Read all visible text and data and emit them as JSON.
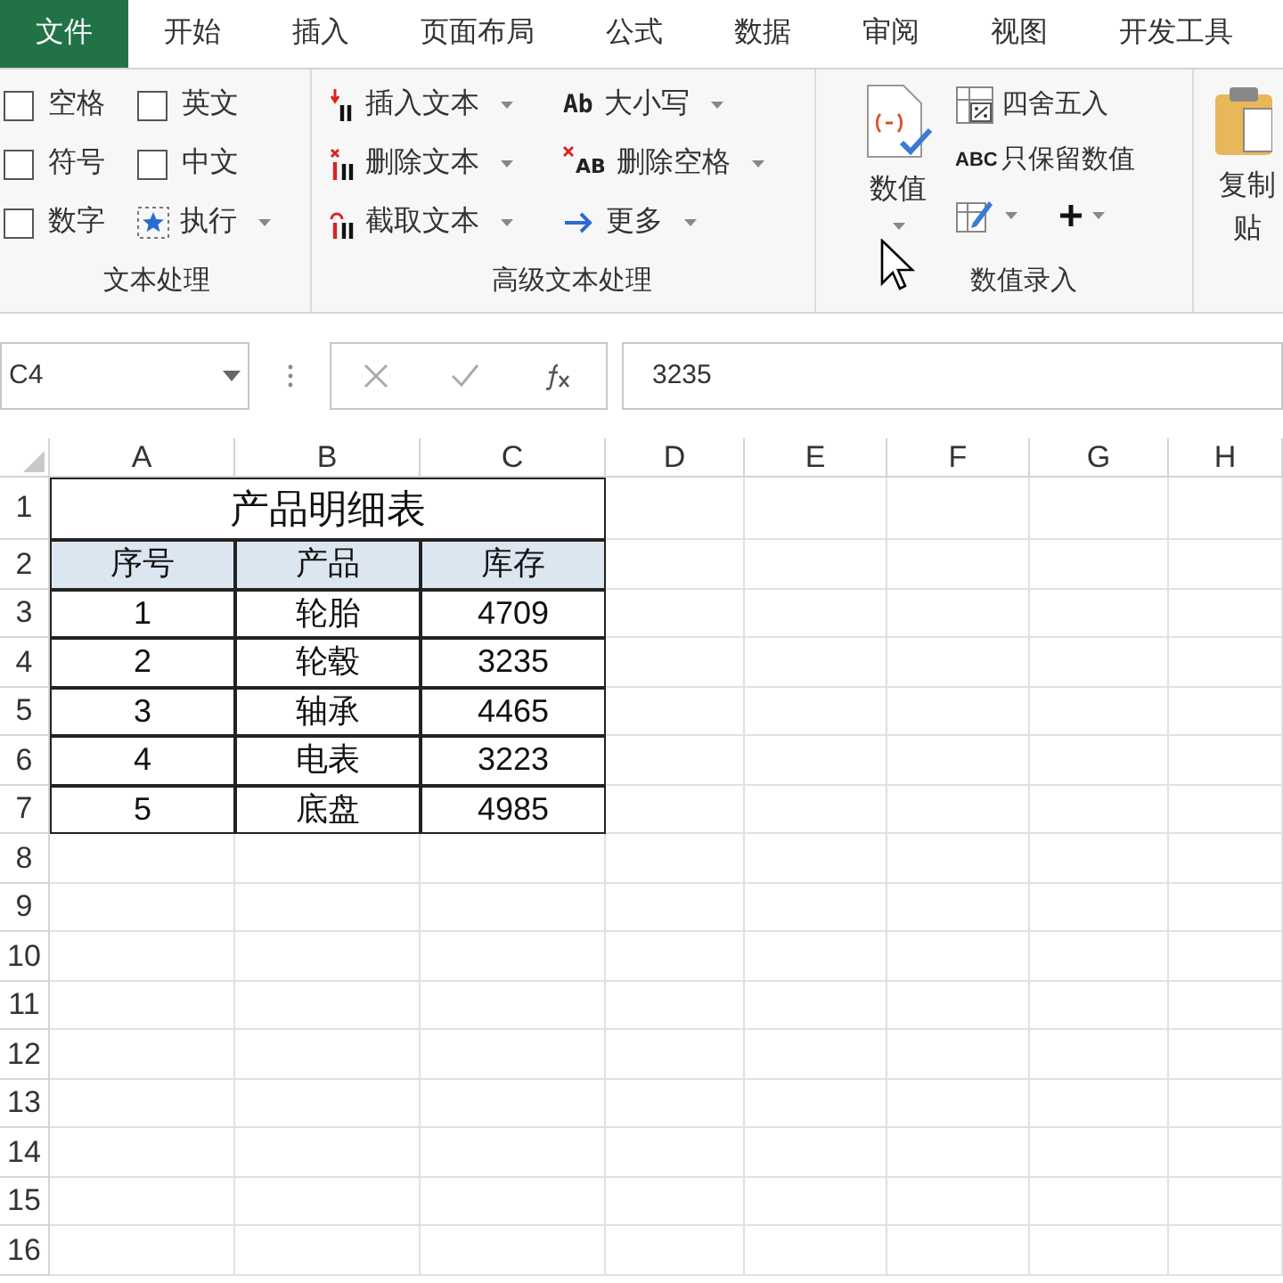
{
  "tabs": [
    {
      "label": "文件",
      "kind": "file"
    },
    {
      "label": "开始",
      "kind": "tab"
    },
    {
      "label": "插入",
      "kind": "tab"
    },
    {
      "label": "页面布局",
      "kind": "tab"
    },
    {
      "label": "公式",
      "kind": "tab"
    },
    {
      "label": "数据",
      "kind": "tab"
    },
    {
      "label": "审阅",
      "kind": "tab"
    },
    {
      "label": "视图",
      "kind": "tab"
    },
    {
      "label": "开发工具",
      "kind": "tab"
    }
  ],
  "ribbon": {
    "groups": [
      {
        "label": "文本处理",
        "items": [
          {
            "kind": "checkbox",
            "label": "空格",
            "checked": false
          },
          {
            "kind": "checkbox",
            "label": "英文",
            "checked": false
          },
          {
            "kind": "checkbox",
            "label": "符号",
            "checked": false
          },
          {
            "kind": "checkbox",
            "label": "中文",
            "checked": false
          },
          {
            "kind": "checkbox",
            "label": "数字",
            "checked": false
          },
          {
            "kind": "menu",
            "label": "执行"
          }
        ]
      },
      {
        "label": "高级文本处理",
        "items": [
          {
            "kind": "menu",
            "label": "插入文本"
          },
          {
            "kind": "menu",
            "label": "删除文本"
          },
          {
            "kind": "menu",
            "label": "截取文本"
          },
          {
            "kind": "menu",
            "label": "大小写",
            "icon_text": "Ab"
          },
          {
            "kind": "menu",
            "label": "删除空格",
            "icon_text": "AB"
          },
          {
            "kind": "menu",
            "label": "更多"
          }
        ]
      },
      {
        "label": "数值录入",
        "big": {
          "label": "数值"
        },
        "items": [
          {
            "kind": "button",
            "label": "四舍五入"
          },
          {
            "kind": "button",
            "label": "只保留数值",
            "icon_text": "ABC"
          }
        ]
      },
      {
        "big": {
          "label": "复制",
          "sublabel": "贴"
        }
      }
    ]
  },
  "formula_bar": {
    "name_box": "C4",
    "value": "3235"
  },
  "sheet": {
    "column_headers": [
      "A",
      "B",
      "C",
      "D",
      "E",
      "F",
      "G",
      "H"
    ],
    "row_headers": [
      "1",
      "2",
      "3",
      "4",
      "5",
      "6",
      "7",
      "8",
      "9",
      "10",
      "11",
      "12",
      "13",
      "14",
      "15",
      "16"
    ],
    "table": {
      "title": "产品明细表",
      "columns": [
        "序号",
        "产品",
        "库存"
      ],
      "rows": [
        [
          "1",
          "轮胎",
          "4709"
        ],
        [
          "2",
          "轮毂",
          "3235"
        ],
        [
          "3",
          "轴承",
          "4465"
        ],
        [
          "4",
          "电表",
          "3223"
        ],
        [
          "5",
          "底盘",
          "4985"
        ]
      ]
    }
  }
}
